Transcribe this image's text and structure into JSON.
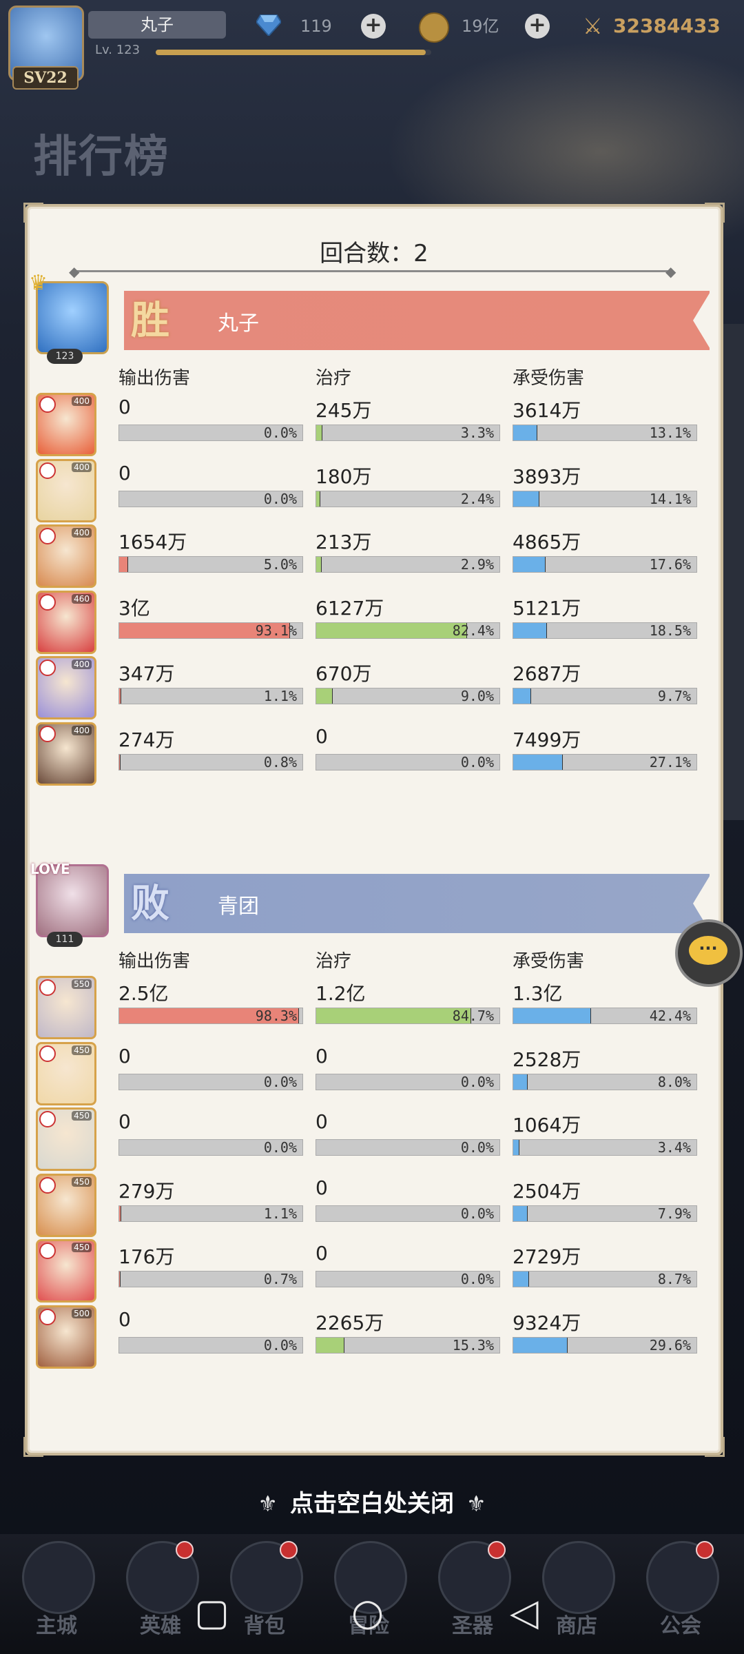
{
  "header": {
    "player_name": "丸子",
    "level": "Lv. 123",
    "sv_badge": "SV22",
    "gems": "119",
    "coins": "19亿",
    "power": "32384433",
    "page_title": "排行榜"
  },
  "panel": {
    "round_label": "回合数：2"
  },
  "winner": {
    "result_char": "胜",
    "name": "丸子",
    "avatar_level": "123",
    "headers": [
      "输出伤害",
      "治疗",
      "承受伤害"
    ],
    "heroes": [
      {
        "level": "400",
        "dmg": "0",
        "dmg_pct": "0.0%",
        "dmg_frac": 0.0,
        "heal": "245万",
        "heal_pct": "3.3%",
        "heal_frac": 0.033,
        "tank": "3614万",
        "tank_pct": "13.1%",
        "tank_frac": 0.131,
        "color": "#e8603a"
      },
      {
        "level": "400",
        "dmg": "0",
        "dmg_pct": "0.0%",
        "dmg_frac": 0.0,
        "heal": "180万",
        "heal_pct": "2.4%",
        "heal_frac": 0.024,
        "tank": "3893万",
        "tank_pct": "14.1%",
        "tank_frac": 0.141,
        "color": "#e8d4a0"
      },
      {
        "level": "400",
        "dmg": "1654万",
        "dmg_pct": "5.0%",
        "dmg_frac": 0.05,
        "heal": "213万",
        "heal_pct": "2.9%",
        "heal_frac": 0.029,
        "tank": "4865万",
        "tank_pct": "17.6%",
        "tank_frac": 0.176,
        "color": "#d88a50"
      },
      {
        "level": "460",
        "dmg": "3亿",
        "dmg_pct": "93.1%",
        "dmg_frac": 0.931,
        "heal": "6127万",
        "heal_pct": "82.4%",
        "heal_frac": 0.824,
        "tank": "5121万",
        "tank_pct": "18.5%",
        "tank_frac": 0.185,
        "color": "#d84040"
      },
      {
        "level": "400",
        "dmg": "347万",
        "dmg_pct": "1.1%",
        "dmg_frac": 0.011,
        "heal": "670万",
        "heal_pct": "9.0%",
        "heal_frac": 0.09,
        "tank": "2687万",
        "tank_pct": "9.7%",
        "tank_frac": 0.097,
        "color": "#9a90d8"
      },
      {
        "level": "400",
        "dmg": "274万",
        "dmg_pct": "0.8%",
        "dmg_frac": 0.008,
        "heal": "0",
        "heal_pct": "0.0%",
        "heal_frac": 0.0,
        "tank": "7499万",
        "tank_pct": "27.1%",
        "tank_frac": 0.271,
        "color": "#6a4a3a"
      }
    ]
  },
  "loser": {
    "result_char": "败",
    "name": "青团",
    "avatar_level": "111",
    "avatar_tag": "LOVE",
    "headers": [
      "输出伤害",
      "治疗",
      "承受伤害"
    ],
    "heroes": [
      {
        "level": "550",
        "dmg": "2.5亿",
        "dmg_pct": "98.3%",
        "dmg_frac": 0.983,
        "heal": "1.2亿",
        "heal_pct": "84.7%",
        "heal_frac": 0.847,
        "tank": "1.3亿",
        "tank_pct": "42.4%",
        "tank_frac": 0.424,
        "color": "#c0b8c8"
      },
      {
        "level": "450",
        "dmg": "0",
        "dmg_pct": "0.0%",
        "dmg_frac": 0.0,
        "heal": "0",
        "heal_pct": "0.0%",
        "heal_frac": 0.0,
        "tank": "2528万",
        "tank_pct": "8.0%",
        "tank_frac": 0.08,
        "color": "#f0d8a8"
      },
      {
        "level": "450",
        "dmg": "0",
        "dmg_pct": "0.0%",
        "dmg_frac": 0.0,
        "heal": "0",
        "heal_pct": "0.0%",
        "heal_frac": 0.0,
        "tank": "1064万",
        "tank_pct": "3.4%",
        "tank_frac": 0.034,
        "color": "#d8d8d0"
      },
      {
        "level": "450",
        "dmg": "279万",
        "dmg_pct": "1.1%",
        "dmg_frac": 0.011,
        "heal": "0",
        "heal_pct": "0.0%",
        "heal_frac": 0.0,
        "tank": "2504万",
        "tank_pct": "7.9%",
        "tank_frac": 0.079,
        "color": "#d89050"
      },
      {
        "level": "450",
        "dmg": "176万",
        "dmg_pct": "0.7%",
        "dmg_frac": 0.007,
        "heal": "0",
        "heal_pct": "0.0%",
        "heal_frac": 0.0,
        "tank": "2729万",
        "tank_pct": "8.7%",
        "tank_frac": 0.087,
        "color": "#e05050"
      },
      {
        "level": "500",
        "dmg": "0",
        "dmg_pct": "0.0%",
        "dmg_frac": 0.0,
        "heal": "2265万",
        "heal_pct": "15.3%",
        "heal_frac": 0.153,
        "tank": "9324万",
        "tank_pct": "29.6%",
        "tank_frac": 0.296,
        "color": "#a06040"
      }
    ]
  },
  "close_hint": "点击空白处关闭",
  "bottom_nav": [
    {
      "label": "主城",
      "badge": false
    },
    {
      "label": "英雄",
      "badge": true
    },
    {
      "label": "背包",
      "badge": true
    },
    {
      "label": "冒险",
      "badge": false
    },
    {
      "label": "圣器",
      "badge": true
    },
    {
      "label": "商店",
      "badge": false
    },
    {
      "label": "公会",
      "badge": true
    }
  ],
  "icons": {
    "gem": "diamond-icon",
    "coin": "coin-icon",
    "power": "crossed-swords-icon",
    "chat": "chat-bubble-icon",
    "recent_apps": "square-icon",
    "home": "circle-icon",
    "back": "triangle-back-icon"
  },
  "colors": {
    "win_banner": "#e58a7c",
    "lose_banner": "#8fa0c8",
    "damage_bar": "#e88478",
    "heal_bar": "#a8d078",
    "tank_bar": "#6ab0e8"
  }
}
